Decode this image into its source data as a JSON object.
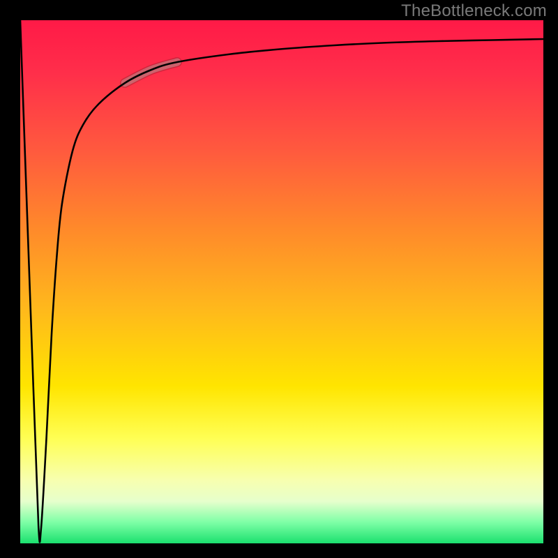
{
  "watermark": "TheBottleneck.com",
  "chart_data": {
    "type": "line",
    "title": "",
    "xlabel": "",
    "ylabel": "",
    "xlim": [
      0,
      100
    ],
    "ylim": [
      0,
      100
    ],
    "grid": false,
    "legend": false,
    "series": [
      {
        "name": "bottleneck-curve",
        "x": [
          0,
          2.5,
          3.5,
          4,
          5,
          6,
          7,
          8,
          10,
          12,
          15,
          20,
          25,
          30,
          40,
          50,
          60,
          70,
          80,
          90,
          100
        ],
        "values": [
          100,
          30,
          3,
          3,
          20,
          40,
          55,
          65,
          75,
          80,
          84,
          88,
          90.5,
          92,
          93.5,
          94.5,
          95.2,
          95.7,
          96,
          96.2,
          96.4
        ]
      }
    ],
    "annotations": [
      {
        "name": "highlighted-segment",
        "x_range": [
          20,
          30
        ],
        "note": "thickened pink/translucent segment on rising curve"
      }
    ],
    "background_gradient": {
      "orientation": "vertical",
      "stops": [
        {
          "pos": 0.0,
          "color": "#ff1a47"
        },
        {
          "pos": 0.4,
          "color": "#ff8a2a"
        },
        {
          "pos": 0.7,
          "color": "#ffe500"
        },
        {
          "pos": 0.92,
          "color": "#e6ffcc"
        },
        {
          "pos": 1.0,
          "color": "#1be06e"
        }
      ]
    }
  }
}
